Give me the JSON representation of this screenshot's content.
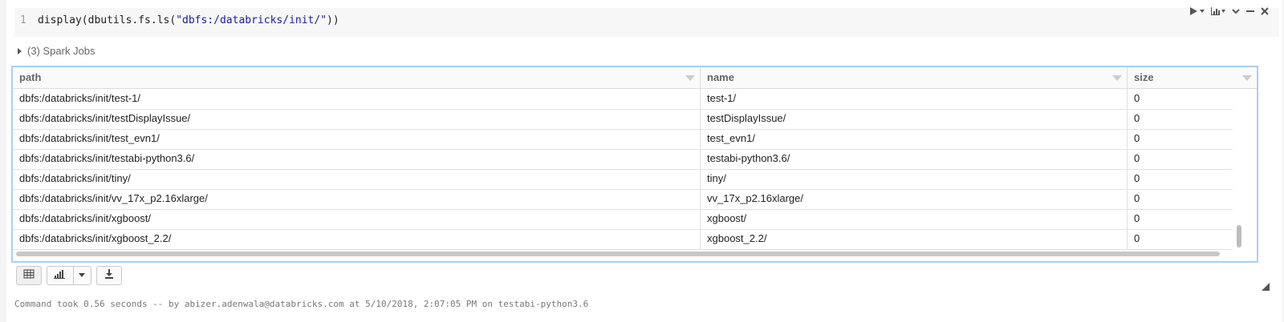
{
  "cell": {
    "line_number": "1",
    "code_prefix": "display(dbutils.fs.ls(",
    "code_string": "\"dbfs:/databricks/init/\"",
    "code_suffix": "))",
    "spark_jobs_label": "(3) Spark Jobs"
  },
  "table": {
    "columns": [
      "path",
      "name",
      "size"
    ],
    "rows": [
      {
        "path": "dbfs:/databricks/init/test-1/",
        "name": "test-1/",
        "size": "0"
      },
      {
        "path": "dbfs:/databricks/init/testDisplayIssue/",
        "name": "testDisplayIssue/",
        "size": "0"
      },
      {
        "path": "dbfs:/databricks/init/test_evn1/",
        "name": "test_evn1/",
        "size": "0"
      },
      {
        "path": "dbfs:/databricks/init/testabi-python3.6/",
        "name": "testabi-python3.6/",
        "size": "0"
      },
      {
        "path": "dbfs:/databricks/init/tiny/",
        "name": "tiny/",
        "size": "0"
      },
      {
        "path": "dbfs:/databricks/init/vv_17x_p2.16xlarge/",
        "name": "vv_17x_p2.16xlarge/",
        "size": "0"
      },
      {
        "path": "dbfs:/databricks/init/xgboost/",
        "name": "xgboost/",
        "size": "0"
      },
      {
        "path": "dbfs:/databricks/init/xgboost_2.2/",
        "name": "xgboost_2.2/",
        "size": "0"
      }
    ]
  },
  "icons": {
    "run": "run-icon",
    "chart": "bar-chart-icon",
    "collapse": "chevron-down-icon",
    "minimize": "minimize-icon",
    "close": "close-icon",
    "table_view": "table-icon",
    "plot_view": "bar-chart-icon",
    "download": "download-icon"
  },
  "footer": {
    "text": "Command took 0.56 seconds -- by abizer.adenwala@databricks.com at 5/10/2018, 2:07:05 PM on testabi-python3.6"
  },
  "colors": {
    "string_literal": "#1a1aa6",
    "table_border_focus": "#a8cff0"
  }
}
